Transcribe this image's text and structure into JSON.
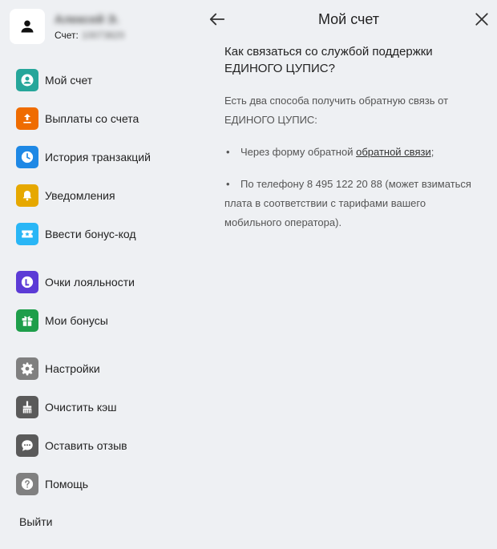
{
  "user": {
    "name": "Алексей Э.",
    "account_label": "Счет:",
    "account_number": "10073820"
  },
  "menu": {
    "items": [
      {
        "label": "Мой счет",
        "icon": "account-icon",
        "color": "#26a69a"
      },
      {
        "label": "Выплаты со счета",
        "icon": "upload-icon",
        "color": "#ef6c00"
      },
      {
        "label": "История транзакций",
        "icon": "clock-icon",
        "color": "#1e88e5"
      },
      {
        "label": "Уведомления",
        "icon": "bell-icon",
        "color": "#e6a800"
      },
      {
        "label": "Ввести бонус-код",
        "icon": "ticket-icon",
        "color": "#29b6f6"
      },
      {
        "label": "Очки лояльности",
        "icon": "loyalty-icon",
        "color": "#5c3bd6"
      },
      {
        "label": "Мои бонусы",
        "icon": "gift-icon",
        "color": "#1e9e4a"
      },
      {
        "label": "Настройки",
        "icon": "gear-icon",
        "color": "#808080"
      },
      {
        "label": "Очистить кэш",
        "icon": "broom-icon",
        "color": "#5a5a5a"
      },
      {
        "label": "Оставить отзыв",
        "icon": "chat-icon",
        "color": "#5a5a5a"
      },
      {
        "label": "Помощь",
        "icon": "help-icon",
        "color": "#808080"
      }
    ],
    "logout_label": "Выйти"
  },
  "header": {
    "title": "Мой счет"
  },
  "article": {
    "title_line1": "Как связаться со службой поддержки",
    "title_line2": "ЕДИНОГО ЦУПИС?",
    "intro": "Есть два способа получить обратную связь от ЕДИНОГО ЦУПИС:",
    "bullet_marker": "•",
    "bullet1_prefix": "Через форму обратной",
    "bullet1_link": "обратной связи",
    "bullet1_suffix": ";",
    "bullet2": "По телефону 8 495 122 20 88 (может взиматься плата в соответствии с тарифами вашего мобильного оператора)."
  }
}
